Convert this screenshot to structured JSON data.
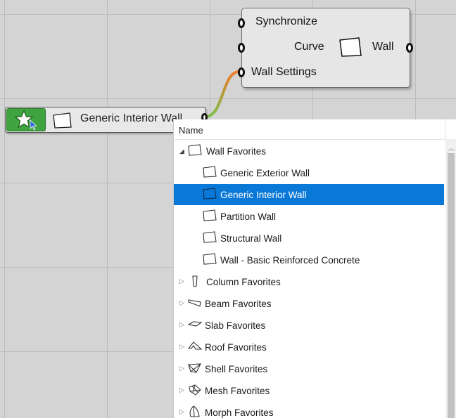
{
  "component": {
    "inputs": [
      "Synchronize",
      "Curve",
      "Wall Settings"
    ],
    "output": "Wall"
  },
  "parameter": {
    "label": "Generic Interior Wall",
    "button_icon": "star-cursor-icon"
  },
  "dropdown": {
    "header": "Name",
    "groups": [
      {
        "label": "Wall Favorites",
        "icon": "wall-icon",
        "expanded": true,
        "children": [
          {
            "label": "Generic Exterior Wall"
          },
          {
            "label": "Generic Interior Wall",
            "selected": true
          },
          {
            "label": "Partition Wall"
          },
          {
            "label": "Structural Wall"
          },
          {
            "label": "Wall - Basic Reinforced Concrete"
          }
        ]
      },
      {
        "label": "Column Favorites",
        "icon": "column-icon"
      },
      {
        "label": "Beam Favorites",
        "icon": "beam-icon"
      },
      {
        "label": "Slab Favorites",
        "icon": "slab-icon"
      },
      {
        "label": "Roof Favorites",
        "icon": "roof-icon"
      },
      {
        "label": "Shell Favorites",
        "icon": "shell-icon"
      },
      {
        "label": "Mesh Favorites",
        "icon": "mesh-icon"
      },
      {
        "label": "Morph Favorites",
        "icon": "morph-icon"
      }
    ]
  },
  "colors": {
    "selection": "#0a78d7",
    "favorite_button": "#3fa33f",
    "wire_start": "#ee7b2e",
    "wire_end": "#7cc04a"
  }
}
